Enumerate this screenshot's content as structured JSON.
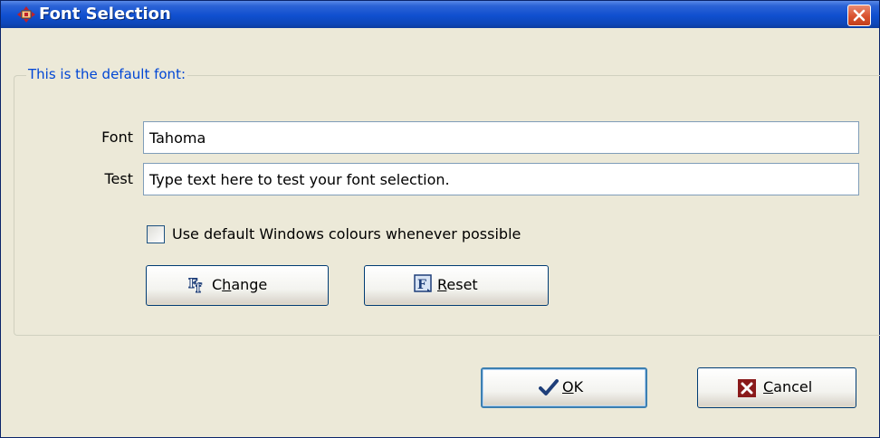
{
  "window": {
    "title": "Font Selection"
  },
  "group": {
    "label": "This is the default font:"
  },
  "font": {
    "label": "Font",
    "value": "Tahoma"
  },
  "test": {
    "label": "Test",
    "value": "Type text here to test your font selection."
  },
  "checkbox": {
    "label": "Use default Windows colours whenever possible",
    "checked": false
  },
  "buttons": {
    "change": {
      "access_key": "h",
      "rest": "ange",
      "prefix": "C",
      "icon": "font-change-icon"
    },
    "reset": {
      "access_key": "R",
      "rest": "eset",
      "icon": "font-reset-icon"
    },
    "ok": {
      "access_key": "O",
      "rest": "K",
      "icon": "checkmark-icon"
    },
    "cancel": {
      "access_key": "C",
      "rest": "ancel",
      "icon": "x-icon"
    }
  },
  "colors": {
    "title_bar": "#0f4fcf",
    "group_label": "#0046d5",
    "cancel_icon": "#8a1a1a",
    "ok_icon": "#1f3f7a"
  }
}
